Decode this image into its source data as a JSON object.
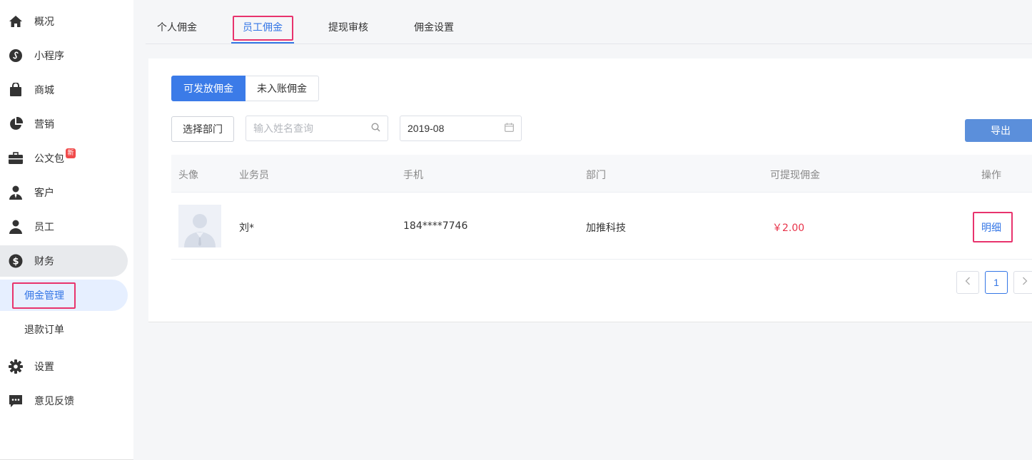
{
  "sidebar": {
    "items": [
      {
        "label": "概况",
        "icon": "home-icon"
      },
      {
        "label": "小程序",
        "icon": "mini-program-icon"
      },
      {
        "label": "商城",
        "icon": "shopping-bag-icon"
      },
      {
        "label": "营销",
        "icon": "pie-chart-icon"
      },
      {
        "label": "公文包",
        "icon": "briefcase-icon",
        "badge": "新"
      },
      {
        "label": "客户",
        "icon": "customer-icon"
      },
      {
        "label": "员工",
        "icon": "employee-icon"
      },
      {
        "label": "财务",
        "icon": "dollar-icon"
      }
    ],
    "finance_sub": [
      "佣金管理",
      "退款订单"
    ],
    "bottom_items": [
      {
        "label": "设置",
        "icon": "gear-icon"
      },
      {
        "label": "意见反馈",
        "icon": "feedback-icon"
      }
    ]
  },
  "tabs": [
    "个人佣金",
    "员工佣金",
    "提现审核",
    "佣金设置"
  ],
  "segment": {
    "on": "可发放佣金",
    "off": "未入账佣金"
  },
  "filters": {
    "dept_button": "选择部门",
    "search_placeholder": "输入姓名查询",
    "date_value": "2019-08",
    "export_button": "导出"
  },
  "table": {
    "headers": [
      "头像",
      "业务员",
      "手机",
      "部门",
      "可提现佣金",
      "操作"
    ],
    "rows": [
      {
        "name": "刘*",
        "phone": "184****7746",
        "dept": "加推科技",
        "amount": "￥2.00",
        "action": "明细"
      }
    ]
  },
  "pagination": {
    "current": "1"
  },
  "colors": {
    "accent": "#3476e6",
    "highlight": "#e8336d",
    "price": "#e8334a"
  }
}
